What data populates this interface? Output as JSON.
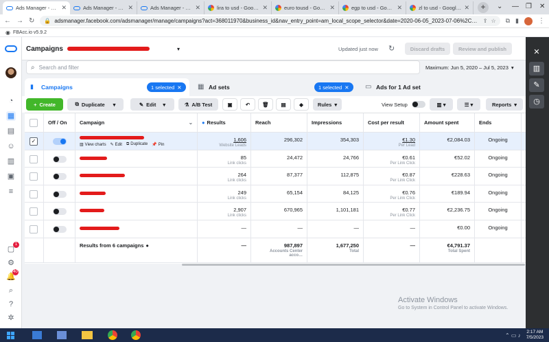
{
  "browser": {
    "tabs": [
      {
        "title": "Ads Manager - Ma…",
        "favicon": "meta-icon",
        "active": true
      },
      {
        "title": "Ads Manager - Ma…",
        "favicon": "meta-icon"
      },
      {
        "title": "Ads Manager - Ma…",
        "favicon": "meta-icon"
      },
      {
        "title": "lira to usd - Google",
        "favicon": "google-icon"
      },
      {
        "title": "euro tousd - Google",
        "favicon": "google-icon"
      },
      {
        "title": "egp to usd - Google",
        "favicon": "google-icon"
      },
      {
        "title": "zl to usd - Google B",
        "favicon": "google-icon"
      }
    ],
    "url": "adsmanager.facebook.com/adsmanager/manage/campaigns?act=368011970&business_id&nav_entry_point=am_local_scope_selector&date=2020-06-05_2023-07-06%2Cmaximu...",
    "extension_label": "FBAcc.io v5.9.2"
  },
  "header": {
    "title": "Campaigns",
    "updated": "Updated just now",
    "discard": "Discard drafts",
    "review": "Review and publish"
  },
  "search": {
    "placeholder": "Search and filter",
    "date_range": "Maximum: Jun 5, 2020 – Jul 5, 2023"
  },
  "level_tabs": {
    "campaigns": {
      "label": "Campaigns",
      "selected": "1 selected"
    },
    "adsets": {
      "label": "Ad sets",
      "selected": "1 selected"
    },
    "ads": {
      "label": "Ads for 1 Ad set"
    }
  },
  "toolbar": {
    "create": "Create",
    "duplicate": "Duplicate",
    "edit": "Edit",
    "ab_test": "A/B Test",
    "rules": "Rules",
    "view_setup": "View Setup",
    "reports": "Reports"
  },
  "table": {
    "columns": [
      "Off / On",
      "Campaign",
      "Results",
      "Reach",
      "Impressions",
      "Cost per result",
      "Amount spent",
      "Ends"
    ],
    "row_actions": [
      "View charts",
      "Edit",
      "Duplicate",
      "Pin"
    ],
    "rows": [
      {
        "on": true,
        "selected": true,
        "results": "1,606",
        "results_sub": "Website Leads",
        "reach": "296,302",
        "impressions": "354,303",
        "cpr": "€1.30",
        "cpr_sub": "Per Lead",
        "spent": "€2,084.03",
        "ends": "Ongoing"
      },
      {
        "on": false,
        "results": "85",
        "results_sub": "Link clicks",
        "reach": "24,472",
        "impressions": "24,766",
        "cpr": "€0.61",
        "cpr_sub": "Per Link Click",
        "spent": "€52.02",
        "ends": "Ongoing"
      },
      {
        "on": false,
        "results": "264",
        "results_sub": "Link clicks",
        "reach": "87,377",
        "impressions": "112,875",
        "cpr": "€0.87",
        "cpr_sub": "Per Link Click",
        "spent": "€228.63",
        "ends": "Ongoing"
      },
      {
        "on": false,
        "results": "249",
        "results_sub": "Link clicks",
        "reach": "65,154",
        "impressions": "84,125",
        "cpr": "€0.76",
        "cpr_sub": "Per Link Click",
        "spent": "€189.94",
        "ends": "Ongoing"
      },
      {
        "on": false,
        "results": "2,907",
        "results_sub": "Link clicks",
        "reach": "670,965",
        "impressions": "1,101,181",
        "cpr": "€0.77",
        "cpr_sub": "Per Link Click",
        "spent": "€2,236.75",
        "ends": "Ongoing"
      },
      {
        "on": false,
        "results": "—",
        "results_sub": "",
        "reach": "—",
        "impressions": "—",
        "cpr": "—",
        "cpr_sub": "",
        "spent": "€0.00",
        "ends": "Ongoing"
      }
    ],
    "totals": {
      "label": "Results from 6 campaigns",
      "results": "—",
      "reach": "987,897",
      "reach_sub": "Accounts Center acco…",
      "impressions": "1,677,250",
      "impressions_sub": "Total",
      "cpr": "—",
      "spent": "€4,791.37",
      "spent_sub": "Total Spent"
    }
  },
  "watermark": {
    "title": "Activate Windows",
    "sub": "Go to System in Control Panel to activate Windows."
  },
  "taskbar": {
    "time": "2:17 AM",
    "date": "7/5/2023"
  },
  "rail_badges": {
    "notifications": "1",
    "alerts": "40"
  },
  "colors": {
    "accent": "#1877f2",
    "create": "#42b72a",
    "redaction": "#e31b1b"
  }
}
